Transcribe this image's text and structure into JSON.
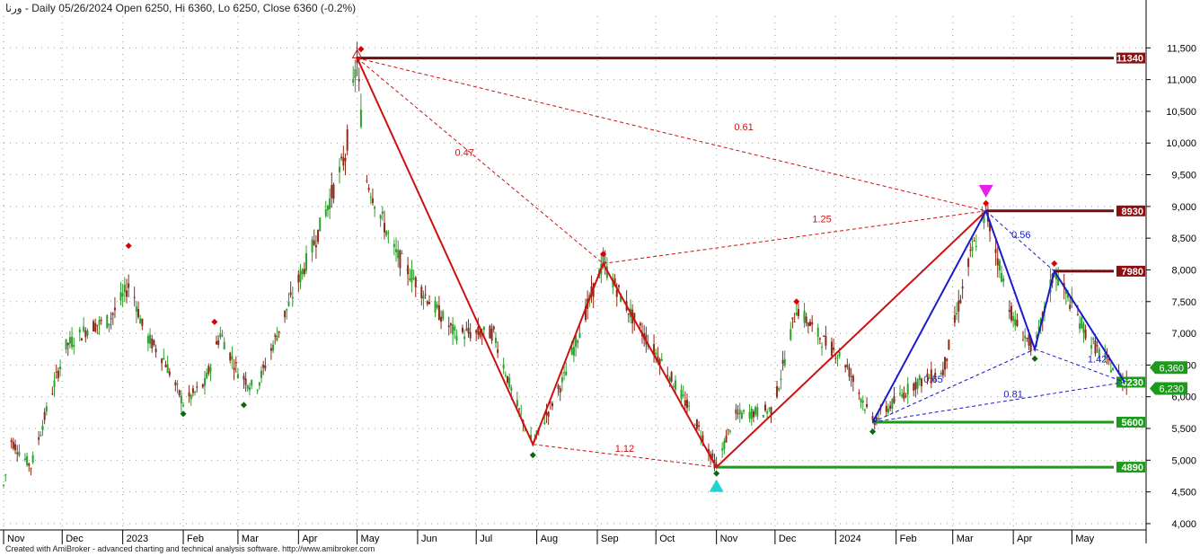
{
  "header": {
    "title": "ورنا - Daily 05/26/2024 Open 6250, Hi 6360, Lo 6250, Close 6360 (-0.2%)"
  },
  "footer": {
    "text": "Created with AmiBroker - advanced charting and technical analysis software. http://www.amibroker.com"
  },
  "colors": {
    "background": "#ffffff",
    "candle_up": "#2ea02e",
    "candle_down": "#8b2b1a",
    "pattern_red": "#cc1111",
    "pattern_blue": "#1a1acc",
    "level_dark_red": "#6e1010",
    "level_green": "#1c9a1c",
    "label_red_bg": "#8b1010",
    "label_green_bg": "#1c9a1c",
    "grid": "#9a9a9a"
  },
  "chart_data": {
    "type": "candlestick",
    "title": "ورنا - Daily 05/26/2024 Open 6250, Hi 6360, Lo 6250, Close 6360 (-0.2%)",
    "grid": true,
    "y_axis": {
      "position": "right",
      "ylim": [
        3900,
        12000
      ],
      "ticks": [
        {
          "v": 4000,
          "label": "4,000"
        },
        {
          "v": 4500,
          "label": "4,500"
        },
        {
          "v": 5000,
          "label": "5,000"
        },
        {
          "v": 5500,
          "label": "5,500"
        },
        {
          "v": 6000,
          "label": "6,000"
        },
        {
          "v": 6500,
          "label": "6,500"
        },
        {
          "v": 7000,
          "label": "7,000"
        },
        {
          "v": 7500,
          "label": "7,500"
        },
        {
          "v": 8000,
          "label": "8,000"
        },
        {
          "v": 8500,
          "label": "8,500"
        },
        {
          "v": 9000,
          "label": "9,000"
        },
        {
          "v": 9500,
          "label": "9,500"
        },
        {
          "v": 10000,
          "label": "10,000"
        },
        {
          "v": 10500,
          "label": "10,500"
        },
        {
          "v": 11000,
          "label": "11,000"
        },
        {
          "v": 11500,
          "label": "11,500"
        }
      ]
    },
    "x_axis": {
      "start": "2022-11-01",
      "end": "2024-06-08",
      "ticks": [
        {
          "date": "2022-11-01",
          "label": "Nov"
        },
        {
          "date": "2022-12-01",
          "label": "Dec"
        },
        {
          "date": "2023-01-01",
          "label": "2023"
        },
        {
          "date": "2023-02-01",
          "label": "Feb"
        },
        {
          "date": "2023-03-01",
          "label": "Mar"
        },
        {
          "date": "2023-04-01",
          "label": "Apr"
        },
        {
          "date": "2023-05-01",
          "label": "May"
        },
        {
          "date": "2023-06-01",
          "label": "Jun"
        },
        {
          "date": "2023-07-01",
          "label": "Jul"
        },
        {
          "date": "2023-08-01",
          "label": "Aug"
        },
        {
          "date": "2023-09-01",
          "label": "Sep"
        },
        {
          "date": "2023-10-01",
          "label": "Oct"
        },
        {
          "date": "2023-11-01",
          "label": "Nov"
        },
        {
          "date": "2023-12-01",
          "label": "Dec"
        },
        {
          "date": "2024-01-01",
          "label": "2024"
        },
        {
          "date": "2024-02-01",
          "label": "Feb"
        },
        {
          "date": "2024-03-01",
          "label": "Mar"
        },
        {
          "date": "2024-04-01",
          "label": "Apr"
        },
        {
          "date": "2024-05-01",
          "label": "May"
        }
      ]
    },
    "price_path": [
      {
        "date": "2022-11-01",
        "v": 4600
      },
      {
        "date": "2022-11-05",
        "v": 5300
      },
      {
        "date": "2022-11-15",
        "v": 4900
      },
      {
        "date": "2022-11-25",
        "v": 6000
      },
      {
        "date": "2022-12-03",
        "v": 6800
      },
      {
        "date": "2022-12-15",
        "v": 7100
      },
      {
        "date": "2022-12-25",
        "v": 7200
      },
      {
        "date": "2023-01-05",
        "v": 7800
      },
      {
        "date": "2023-01-12",
        "v": 7000
      },
      {
        "date": "2023-01-22",
        "v": 6600
      },
      {
        "date": "2023-02-01",
        "v": 5900
      },
      {
        "date": "2023-02-12",
        "v": 6200
      },
      {
        "date": "2023-02-20",
        "v": 7000
      },
      {
        "date": "2023-03-01",
        "v": 6400
      },
      {
        "date": "2023-03-10",
        "v": 6100
      },
      {
        "date": "2023-03-25",
        "v": 7300
      },
      {
        "date": "2023-04-10",
        "v": 8500
      },
      {
        "date": "2023-04-25",
        "v": 9800
      },
      {
        "date": "2023-05-01",
        "v": 11340
      },
      {
        "date": "2023-05-05",
        "v": 9500
      },
      {
        "date": "2023-05-20",
        "v": 8300
      },
      {
        "date": "2023-06-05",
        "v": 7600
      },
      {
        "date": "2023-06-20",
        "v": 7000
      },
      {
        "date": "2023-07-10",
        "v": 7000
      },
      {
        "date": "2023-07-20",
        "v": 6000
      },
      {
        "date": "2023-07-30",
        "v": 5250
      },
      {
        "date": "2023-08-15",
        "v": 6300
      },
      {
        "date": "2023-08-30",
        "v": 7700
      },
      {
        "date": "2023-09-04",
        "v": 8100
      },
      {
        "date": "2023-09-20",
        "v": 7200
      },
      {
        "date": "2023-10-05",
        "v": 6500
      },
      {
        "date": "2023-10-20",
        "v": 5700
      },
      {
        "date": "2023-11-01",
        "v": 4890
      },
      {
        "date": "2023-11-10",
        "v": 5700
      },
      {
        "date": "2023-11-30",
        "v": 5800
      },
      {
        "date": "2023-12-12",
        "v": 7400
      },
      {
        "date": "2023-12-25",
        "v": 6900
      },
      {
        "date": "2024-01-05",
        "v": 6600
      },
      {
        "date": "2024-01-20",
        "v": 5600
      },
      {
        "date": "2024-02-10",
        "v": 6200
      },
      {
        "date": "2024-02-25",
        "v": 6400
      },
      {
        "date": "2024-03-10",
        "v": 8200
      },
      {
        "date": "2024-03-18",
        "v": 8930
      },
      {
        "date": "2024-04-01",
        "v": 7200
      },
      {
        "date": "2024-04-12",
        "v": 6750
      },
      {
        "date": "2024-04-22",
        "v": 7980
      },
      {
        "date": "2024-05-10",
        "v": 6900
      },
      {
        "date": "2024-05-28",
        "v": 6230
      },
      {
        "date": "2024-05-31",
        "v": 6360
      }
    ],
    "pattern_lines": [
      {
        "color": "red",
        "width": 2,
        "dashed": false,
        "points": [
          {
            "date": "2023-05-01",
            "v": 11340
          },
          {
            "date": "2023-07-30",
            "v": 5250
          },
          {
            "date": "2023-09-04",
            "v": 8100
          },
          {
            "date": "2023-11-01",
            "v": 4890
          },
          {
            "date": "2024-03-18",
            "v": 8930
          }
        ]
      },
      {
        "color": "red",
        "width": 1,
        "dashed": true,
        "points": [
          {
            "date": "2023-05-01",
            "v": 11340
          },
          {
            "date": "2023-09-04",
            "v": 8100
          }
        ]
      },
      {
        "color": "red",
        "width": 1,
        "dashed": true,
        "points": [
          {
            "date": "2023-05-01",
            "v": 11340
          },
          {
            "date": "2024-03-18",
            "v": 8930
          }
        ]
      },
      {
        "color": "red",
        "width": 1,
        "dashed": true,
        "points": [
          {
            "date": "2023-09-04",
            "v": 8100
          },
          {
            "date": "2024-03-18",
            "v": 8930
          }
        ]
      },
      {
        "color": "red",
        "width": 1,
        "dashed": true,
        "points": [
          {
            "date": "2023-07-30",
            "v": 5250
          },
          {
            "date": "2023-11-01",
            "v": 4890
          }
        ]
      },
      {
        "color": "blue",
        "width": 2,
        "dashed": false,
        "points": [
          {
            "date": "2024-01-20",
            "v": 5600
          },
          {
            "date": "2024-03-18",
            "v": 8930
          },
          {
            "date": "2024-04-12",
            "v": 6750
          },
          {
            "date": "2024-04-22",
            "v": 7980
          },
          {
            "date": "2024-05-28",
            "v": 6230
          }
        ]
      },
      {
        "color": "blue",
        "width": 1,
        "dashed": true,
        "points": [
          {
            "date": "2024-03-18",
            "v": 8930
          },
          {
            "date": "2024-04-22",
            "v": 7980
          }
        ]
      },
      {
        "color": "blue",
        "width": 1,
        "dashed": true,
        "points": [
          {
            "date": "2024-01-20",
            "v": 5600
          },
          {
            "date": "2024-04-12",
            "v": 6750
          }
        ]
      },
      {
        "color": "blue",
        "width": 1,
        "dashed": true,
        "points": [
          {
            "date": "2024-04-12",
            "v": 6750
          },
          {
            "date": "2024-05-28",
            "v": 6230
          }
        ]
      },
      {
        "color": "blue",
        "width": 1,
        "dashed": true,
        "points": [
          {
            "date": "2024-01-20",
            "v": 5600
          },
          {
            "date": "2024-05-28",
            "v": 6230
          }
        ]
      }
    ],
    "ratio_labels": [
      {
        "text": "0.47",
        "date": "2023-06-25",
        "v": 9800,
        "color": "red"
      },
      {
        "text": "0.61",
        "date": "2023-11-15",
        "v": 10200,
        "color": "red"
      },
      {
        "text": "1.25",
        "date": "2023-12-25",
        "v": 8750,
        "color": "red"
      },
      {
        "text": "1.12",
        "date": "2023-09-15",
        "v": 5130,
        "color": "red"
      },
      {
        "text": "0.56",
        "date": "2024-04-05",
        "v": 8500,
        "color": "blue"
      },
      {
        "text": "0.65",
        "date": "2024-02-20",
        "v": 6220,
        "color": "blue"
      },
      {
        "text": "0.81",
        "date": "2024-04-01",
        "v": 5990,
        "color": "blue"
      },
      {
        "text": "1.42",
        "date": "2024-05-14",
        "v": 6540,
        "color": "blue"
      }
    ],
    "levels": [
      {
        "value": 11340,
        "label": "11340",
        "from": "2023-05-01",
        "color": "dark_red"
      },
      {
        "value": 8930,
        "label": "8930",
        "from": "2024-03-18",
        "color": "dark_red"
      },
      {
        "value": 7980,
        "label": "7980",
        "from": "2024-04-22",
        "color": "dark_red"
      },
      {
        "value": 6230,
        "label": "6230",
        "from": null,
        "color": "green"
      },
      {
        "value": 5600,
        "label": "5600",
        "from": "2024-01-20",
        "color": "green"
      },
      {
        "value": 4890,
        "label": "4890",
        "from": "2023-11-01",
        "color": "green"
      }
    ],
    "axis_price_badges": [
      {
        "value": 6360,
        "label": "6,360"
      },
      {
        "value": 6230,
        "label": "6,230"
      }
    ],
    "markers": [
      {
        "type": "down-triangle",
        "date": "2024-03-18",
        "v": 9240,
        "color": "#e61ee6"
      },
      {
        "type": "up-triangle",
        "date": "2023-11-01",
        "v": 4600,
        "color": "#22d3d3"
      },
      {
        "type": "x-mark",
        "date": "2023-05-01",
        "v": 11400,
        "color": "#cc1111"
      },
      {
        "type": "red-dot",
        "date": "2023-05-03",
        "v": 11480
      },
      {
        "type": "red-dot",
        "date": "2023-01-04",
        "v": 8380
      },
      {
        "type": "red-dot",
        "date": "2023-02-17",
        "v": 7180
      },
      {
        "type": "red-dot",
        "date": "2023-09-04",
        "v": 8250
      },
      {
        "type": "red-dot",
        "date": "2023-12-12",
        "v": 7500
      },
      {
        "type": "red-dot",
        "date": "2024-03-18",
        "v": 9050
      },
      {
        "type": "red-dot",
        "date": "2024-04-22",
        "v": 8100
      },
      {
        "type": "green-dot",
        "date": "2023-02-01",
        "v": 5730
      },
      {
        "type": "green-dot",
        "date": "2023-03-04",
        "v": 5870
      },
      {
        "type": "green-dot",
        "date": "2023-07-30",
        "v": 5080
      },
      {
        "type": "green-dot",
        "date": "2023-11-01",
        "v": 4790
      },
      {
        "type": "green-dot",
        "date": "2024-01-20",
        "v": 5450
      },
      {
        "type": "green-dot",
        "date": "2024-04-12",
        "v": 6600
      }
    ]
  }
}
